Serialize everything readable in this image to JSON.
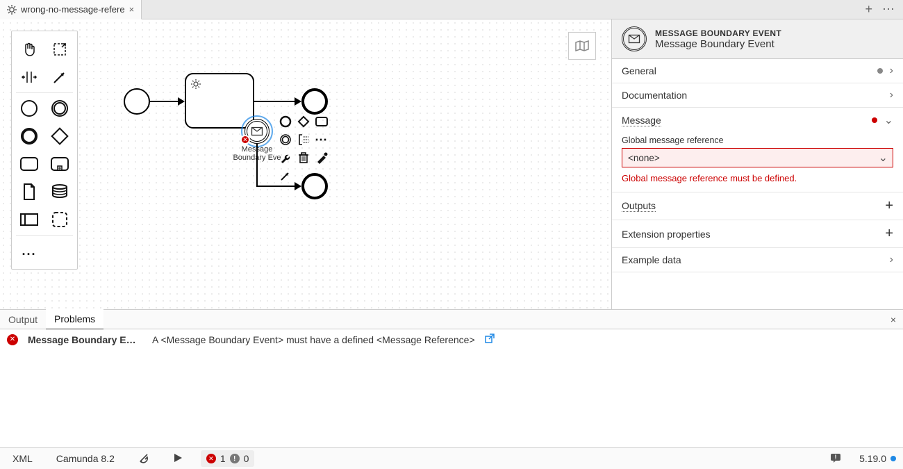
{
  "tab": {
    "title": "wrong-no-message-refere",
    "close": "×"
  },
  "tabbar_right": {
    "add": "+",
    "more": "⋯"
  },
  "properties": {
    "type": "MESSAGE BOUNDARY EVENT",
    "name": "Message Boundary Event",
    "sections": {
      "general": {
        "title": "General"
      },
      "documentation": {
        "title": "Documentation"
      },
      "message": {
        "title": "Message",
        "field_label": "Global message reference",
        "value": "<none>",
        "error": "Global message reference must be defined."
      },
      "outputs": {
        "title": "Outputs"
      },
      "extension": {
        "title": "Extension properties"
      },
      "example": {
        "title": "Example data"
      }
    }
  },
  "bottom_tabs": {
    "output": "Output",
    "problems": "Problems",
    "close": "×"
  },
  "problems": [
    {
      "location": "Message Boundary E…",
      "message": "A <Message Boundary Event> must have a defined <Message Reference>"
    }
  ],
  "status": {
    "xml": "XML",
    "engine": "Camunda 8.2",
    "errors": "1",
    "warnings": "0",
    "version": "5.19.0"
  },
  "diagram": {
    "boundary_label_l1": "Message",
    "boundary_label_l2": "Boundary Eve"
  }
}
